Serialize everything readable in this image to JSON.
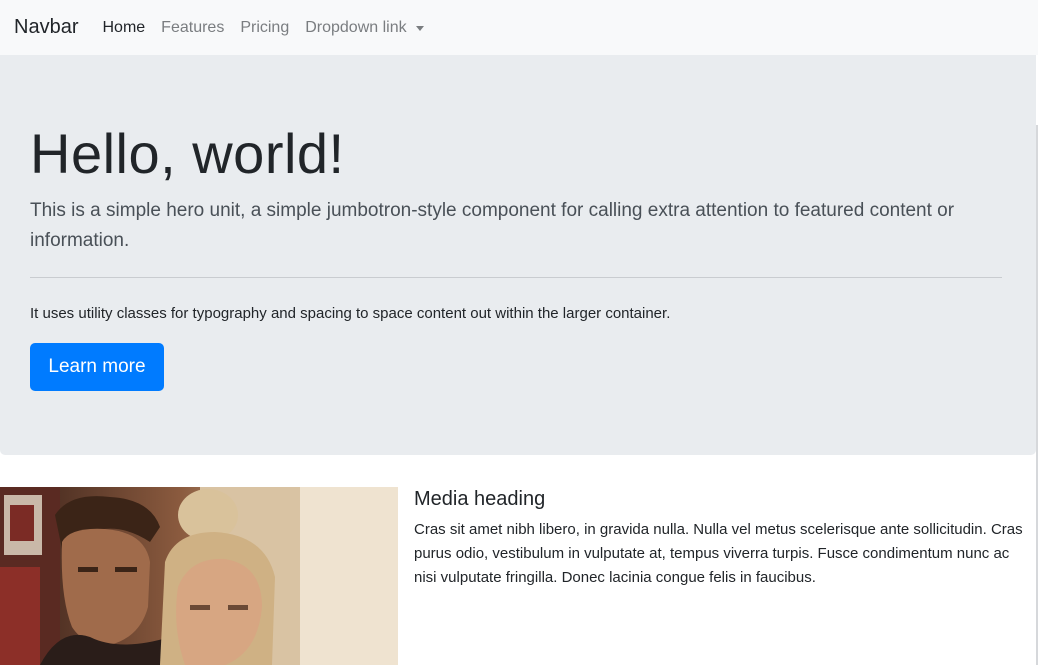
{
  "navbar": {
    "brand": "Navbar",
    "links": [
      {
        "label": "Home",
        "active": true
      },
      {
        "label": "Features",
        "active": false
      },
      {
        "label": "Pricing",
        "active": false
      },
      {
        "label": "Dropdown link",
        "active": false,
        "dropdown": true
      }
    ]
  },
  "jumbotron": {
    "title": "Hello, world!",
    "lead": "This is a simple hero unit, a simple jumbotron-style component for calling extra attention to featured content or information.",
    "body": "It uses utility classes for typography and spacing to space content out within the larger container.",
    "button_label": "Learn more"
  },
  "media": {
    "image_icon": "photo-of-man-and-woman",
    "heading": "Media heading",
    "text": "Cras sit amet nibh libero, in gravida nulla. Nulla vel metus scelerisque ante sollicitudin. Cras purus odio, vestibulum in vulputate at, tempus viverra turpis. Fusce condimentum nunc ac nisi vulputate fringilla. Donec lacinia congue felis in faucibus."
  },
  "colors": {
    "navbar_bg": "#f8f9fa",
    "jumbotron_bg": "#e9ecef",
    "primary": "#007bff"
  }
}
